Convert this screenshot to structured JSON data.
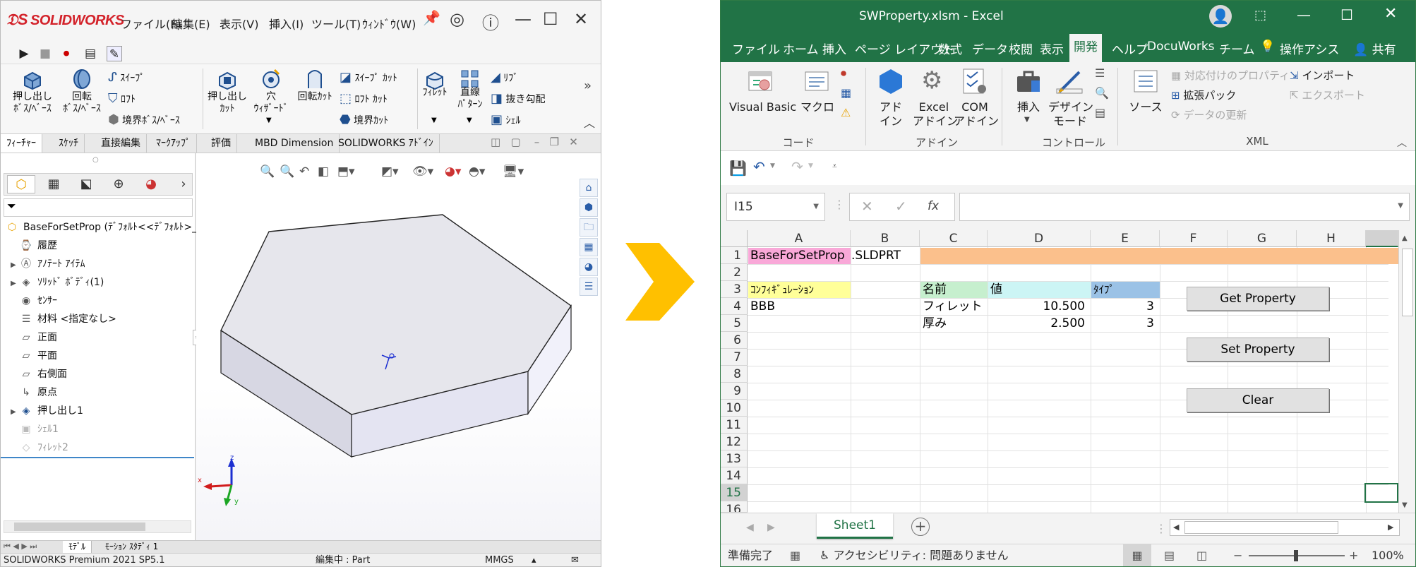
{
  "solidworks": {
    "logo": "SOLIDWORKS",
    "menu": [
      "ファイル(F)",
      "編集(E)",
      "表示(V)",
      "挿入(I)",
      "ツール(T)",
      "ｳｨﾝﾄﾞｳ(W)"
    ],
    "ribbon": {
      "extrude_boss": "押し出し\nﾎﾞｽ/ﾍﾞｰｽ",
      "revolve_boss": "回転\nﾎﾞｽ/ﾍﾞｰｽ",
      "sweep": "ｽｲｰﾌﾟ",
      "loft": "ﾛﾌﾄ",
      "boundary_boss": "境界ﾎﾞｽ/ﾍﾞｰｽ",
      "extrude_cut": "押し出し\nｶｯﾄ",
      "hole_wizard": "穴\nｳｨｻﾞｰﾄﾞ",
      "revolve_cut": "回転ｶｯﾄ",
      "swept_cut": "ｽｲｰﾌﾟ ｶｯﾄ",
      "lofted_cut": "ﾛﾌﾄ ｶｯﾄ",
      "boundary_cut": "境界ｶｯﾄ",
      "fillet": "ﾌｨﾚｯﾄ",
      "linear_pattern": "直線\nﾊﾟﾀｰﾝ",
      "rib": "ﾘﾌﾞ",
      "draft": "抜き勾配",
      "shell": "ｼｪﾙ"
    },
    "tabs": [
      "ﾌｨｰﾁｬｰ",
      "ｽｹｯﾁ",
      "直接編集",
      "ﾏｰｸｱｯﾌﾟ",
      "評価",
      "MBD Dimension",
      "SOLIDWORKS ｱﾄﾞｲﾝ"
    ],
    "tree": {
      "root": "BaseForSetProp  (ﾃﾞﾌｫﾙﾄ<<ﾃﾞﾌｫﾙﾄ>_表",
      "items": [
        {
          "label": "履歴"
        },
        {
          "label": "ｱﾉﾃｰﾄ ｱｲﾃﾑ"
        },
        {
          "label": "ｿﾘｯﾄﾞ ﾎﾞﾃﾞｨ(1)"
        },
        {
          "label": "ｾﾝｻｰ"
        },
        {
          "label": "材料 <指定なし>"
        },
        {
          "label": "正面"
        },
        {
          "label": "平面"
        },
        {
          "label": "右側面"
        },
        {
          "label": "原点"
        },
        {
          "label": "押し出し1"
        },
        {
          "label": "ｼｪﾙ1"
        },
        {
          "label": "ﾌｨﾚｯﾄ2"
        }
      ]
    },
    "bottom_tabs": [
      "ﾓﾃﾞﾙ",
      "ﾓｰｼｮﾝ ｽﾀﾃﾞｨ 1"
    ],
    "status": {
      "product": "SOLIDWORKS Premium 2021 SP5.1",
      "editing": "編集中 : Part",
      "units": "MMGS"
    }
  },
  "excel": {
    "title": "SWProperty.xlsm  -  Excel",
    "tabs": [
      "ファイル",
      "ホーム",
      "挿入",
      "ページ レイアウト",
      "数式",
      "データ",
      "校閲",
      "表示",
      "開発",
      "ヘルプ",
      "DocuWorks",
      "チーム",
      "操作アシス",
      "共有"
    ],
    "ribbon": {
      "visual_basic": "Visual Basic",
      "macro": "マクロ",
      "addin": "アド\nイン",
      "excel_addin": "Excel\nアドイン",
      "com_addin": "COM\nアドイン",
      "insert": "挿入",
      "design_mode": "デザイン\nモード",
      "source": "ソース",
      "map_props": "対応付けのプロパティ",
      "expansion_pack": "拡張パック",
      "refresh_data": "データの更新",
      "import": "インポート",
      "export": "エクスポート",
      "groups": [
        "コード",
        "アドイン",
        "コントロール",
        "XML"
      ]
    },
    "name_box": "I15",
    "columns": [
      "A",
      "B",
      "C",
      "D",
      "E",
      "F",
      "G",
      "H"
    ],
    "rows": [
      "1",
      "2",
      "3",
      "4",
      "5",
      "6",
      "7",
      "8",
      "9",
      "10",
      "11",
      "12",
      "13",
      "14",
      "15",
      "16"
    ],
    "cells": {
      "a1": "BaseForSetProp",
      "b1": ".SLDPRT",
      "a3": "ｺﾝﾌｨｷﾞｭﾚｰｼｮﾝ",
      "c3": "名前",
      "d3": "値",
      "e3": "ﾀｲﾌﾟ",
      "a4": "BBB",
      "c4": "フィレット",
      "d4": "10.500",
      "e4": "3",
      "c5": "厚み",
      "d5": "2.500",
      "e5": "3"
    },
    "buttons": {
      "get": "Get Property",
      "set": "Set Property",
      "clear": "Clear"
    },
    "sheet_tab": "Sheet1",
    "status": {
      "ready": "準備完了",
      "accessibility": "アクセシビリティ: 問題ありません",
      "zoom": "100%"
    },
    "colors": {
      "excel_green": "#217346",
      "pink": "#f9a8d8",
      "orange": "#fbc08c",
      "yellow": "#ffff99",
      "green_cell": "#c6efce",
      "cyan_cell": "#ccf5f5",
      "blue_cell": "#9bc2e6"
    }
  },
  "arrow": {
    "color": "#ffc000"
  }
}
